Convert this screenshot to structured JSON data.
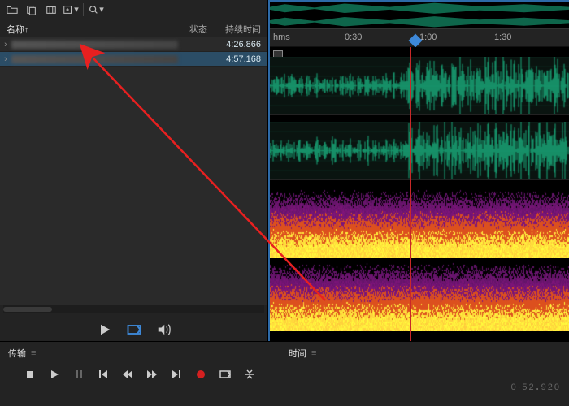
{
  "toolbar": {
    "icons": [
      "folder-icon",
      "new-file-icon",
      "tabs-icon",
      "import-icon"
    ],
    "search_placeholder": "ρ"
  },
  "file_list": {
    "col_name": "名称↑",
    "col_status": "状态",
    "col_duration": "持续时间",
    "rows": [
      {
        "duration": "4:26.866",
        "selected": false
      },
      {
        "duration": "4:57.168",
        "selected": true
      }
    ]
  },
  "preview": {
    "buttons": [
      "play",
      "loop",
      "volume"
    ]
  },
  "timeline": {
    "hms_label": "hms",
    "ticks": [
      {
        "label": "0:30",
        "pct": 25
      },
      {
        "label": "1:00",
        "pct": 50
      },
      {
        "label": "1:30",
        "pct": 75
      }
    ],
    "playhead_pct": 47
  },
  "transport": {
    "title": "传输",
    "buttons": [
      "stop",
      "play",
      "pause",
      "skip-start",
      "rewind",
      "fast-forward",
      "skip-end",
      "record",
      "loop",
      "zoom"
    ]
  },
  "time_panel": {
    "title": "时间",
    "display_major": "0·52",
    "display_minor": "920"
  },
  "colors": {
    "waveform": "#1fe8a8",
    "playhead": "#c82828",
    "selection": "#2b4d66",
    "accent_border": "#2d6aa8"
  }
}
